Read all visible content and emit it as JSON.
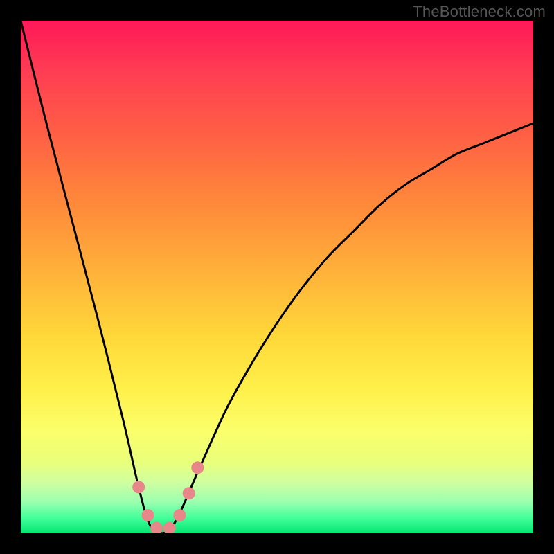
{
  "watermark": "TheBottleneck.com",
  "chart_data": {
    "type": "line",
    "title": "",
    "xlabel": "",
    "ylabel": "",
    "xlim": [
      0,
      1
    ],
    "ylim": [
      0,
      1
    ],
    "x": [
      0.0,
      0.05,
      0.1,
      0.15,
      0.2,
      0.23,
      0.25,
      0.27,
      0.3,
      0.35,
      0.4,
      0.45,
      0.5,
      0.55,
      0.6,
      0.65,
      0.7,
      0.75,
      0.8,
      0.85,
      0.9,
      0.95,
      1.0
    ],
    "values": [
      1.0,
      0.8,
      0.61,
      0.42,
      0.22,
      0.09,
      0.02,
      0.0,
      0.02,
      0.13,
      0.24,
      0.33,
      0.41,
      0.48,
      0.54,
      0.59,
      0.64,
      0.68,
      0.71,
      0.74,
      0.76,
      0.78,
      0.8
    ],
    "minimum_x": 0.27,
    "dots": [
      {
        "x": 0.23,
        "y": 0.09
      },
      {
        "x": 0.248,
        "y": 0.035
      },
      {
        "x": 0.265,
        "y": 0.01
      },
      {
        "x": 0.29,
        "y": 0.01
      },
      {
        "x": 0.31,
        "y": 0.035
      },
      {
        "x": 0.328,
        "y": 0.078
      },
      {
        "x": 0.345,
        "y": 0.128
      }
    ],
    "colors": {
      "top": "#ff1858",
      "mid": "#ffe23a",
      "bottom": "#05e672",
      "curve": "#000000",
      "dot": "#e8878a"
    }
  }
}
